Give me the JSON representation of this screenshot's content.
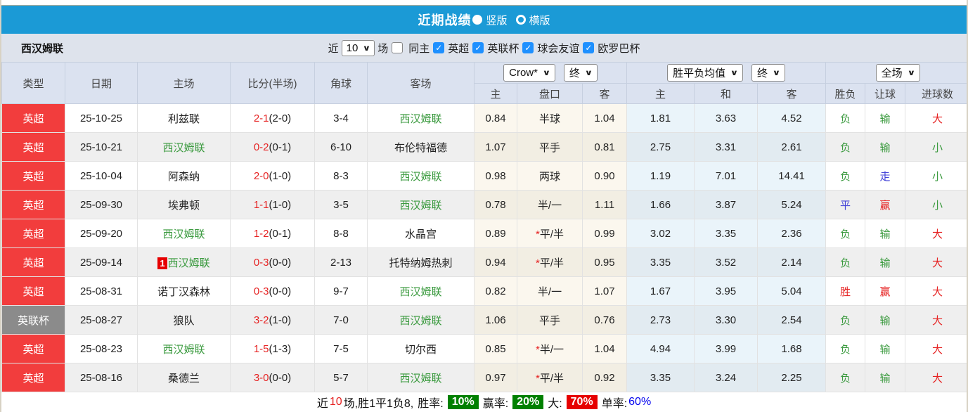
{
  "colors": {
    "titlebar_blue": "#1b9ad6",
    "epl_red": "#f23d3d",
    "cup_gray": "#8b8b8b",
    "team_green": "#3a9a3e",
    "result_red": "#e62222",
    "result_blue": "#4343d8",
    "rate_green_bg": "#008000",
    "rate_red_bg": "#e60000",
    "rate_blue_text": "#0000ee"
  },
  "title_bar": {
    "title": "近期战绩",
    "vertical_label": "竖版",
    "horizontal_label": "横版"
  },
  "filter": {
    "team": "西汉姆联",
    "near_label": "近",
    "match_count": "10",
    "games_label": "场",
    "same_home_label": "同主",
    "leagues": [
      {
        "label": "英超",
        "checked": true
      },
      {
        "label": "英联杯",
        "checked": true
      },
      {
        "label": "球会友谊",
        "checked": true
      },
      {
        "label": "欧罗巴杯",
        "checked": true
      }
    ]
  },
  "table": {
    "left_headers": [
      "类型",
      "日期",
      "主场",
      "比分(半场)",
      "角球",
      "客场"
    ],
    "sub_headers": [
      "主",
      "盘口",
      "客",
      "主",
      "和",
      "客",
      "胜负",
      "让球",
      "进球数"
    ],
    "selects": {
      "company": "Crow*",
      "company_time": "终",
      "europe": "胜平负均值",
      "europe_time": "终",
      "scope": "全场"
    },
    "rows": [
      {
        "league": "英超",
        "league_color": "red",
        "date": "25-10-25",
        "home": {
          "name": "利兹联",
          "self": false,
          "badge": ""
        },
        "score": {
          "ft": "2-1",
          "ht": "(2-0)"
        },
        "corner": "3-4",
        "away": {
          "name": "西汉姆联",
          "self": true
        },
        "asian": {
          "home": "0.84",
          "handicap": "半球",
          "away": "1.04"
        },
        "europe": {
          "home": "1.81",
          "draw": "3.63",
          "away": "4.52"
        },
        "outcome": {
          "text": "负",
          "color": "green"
        },
        "handicap_result": {
          "text": "输",
          "color": "green"
        },
        "goals": {
          "text": "大",
          "color": "red"
        }
      },
      {
        "league": "英超",
        "league_color": "red",
        "date": "25-10-21",
        "home": {
          "name": "西汉姆联",
          "self": true,
          "badge": ""
        },
        "score": {
          "ft": "0-2",
          "ht": "(0-1)"
        },
        "corner": "6-10",
        "away": {
          "name": "布伦特福德",
          "self": false
        },
        "asian": {
          "home": "1.07",
          "handicap": "平手",
          "away": "0.81"
        },
        "europe": {
          "home": "2.75",
          "draw": "3.31",
          "away": "2.61"
        },
        "outcome": {
          "text": "负",
          "color": "green"
        },
        "handicap_result": {
          "text": "输",
          "color": "green"
        },
        "goals": {
          "text": "小",
          "color": "green"
        }
      },
      {
        "league": "英超",
        "league_color": "red",
        "date": "25-10-04",
        "home": {
          "name": "阿森纳",
          "self": false,
          "badge": ""
        },
        "score": {
          "ft": "2-0",
          "ht": "(1-0)"
        },
        "corner": "8-3",
        "away": {
          "name": "西汉姆联",
          "self": true
        },
        "asian": {
          "home": "0.98",
          "handicap": "两球",
          "away": "0.90"
        },
        "europe": {
          "home": "1.19",
          "draw": "7.01",
          "away": "14.41"
        },
        "outcome": {
          "text": "负",
          "color": "green"
        },
        "handicap_result": {
          "text": "走",
          "color": "blue"
        },
        "goals": {
          "text": "小",
          "color": "green"
        }
      },
      {
        "league": "英超",
        "league_color": "red",
        "date": "25-09-30",
        "home": {
          "name": "埃弗顿",
          "self": false,
          "badge": ""
        },
        "score": {
          "ft": "1-1",
          "ht": "(1-0)"
        },
        "corner": "3-5",
        "away": {
          "name": "西汉姆联",
          "self": true
        },
        "asian": {
          "home": "0.78",
          "handicap": "半/一",
          "away": "1.11"
        },
        "europe": {
          "home": "1.66",
          "draw": "3.87",
          "away": "5.24"
        },
        "outcome": {
          "text": "平",
          "color": "blue"
        },
        "handicap_result": {
          "text": "赢",
          "color": "red"
        },
        "goals": {
          "text": "小",
          "color": "green"
        }
      },
      {
        "league": "英超",
        "league_color": "red",
        "date": "25-09-20",
        "home": {
          "name": "西汉姆联",
          "self": true,
          "badge": ""
        },
        "score": {
          "ft": "1-2",
          "ht": "(0-1)"
        },
        "corner": "8-8",
        "away": {
          "name": "水晶宫",
          "self": false
        },
        "asian": {
          "home": "0.89",
          "handicap": "*平/半",
          "away": "0.99"
        },
        "europe": {
          "home": "3.02",
          "draw": "3.35",
          "away": "2.36"
        },
        "outcome": {
          "text": "负",
          "color": "green"
        },
        "handicap_result": {
          "text": "输",
          "color": "green"
        },
        "goals": {
          "text": "大",
          "color": "red"
        }
      },
      {
        "league": "英超",
        "league_color": "red",
        "date": "25-09-14",
        "home": {
          "name": "西汉姆联",
          "self": true,
          "badge": "1"
        },
        "score": {
          "ft": "0-3",
          "ht": "(0-0)"
        },
        "corner": "2-13",
        "away": {
          "name": "托特纳姆热刺",
          "self": false
        },
        "asian": {
          "home": "0.94",
          "handicap": "*平/半",
          "away": "0.95"
        },
        "europe": {
          "home": "3.35",
          "draw": "3.52",
          "away": "2.14"
        },
        "outcome": {
          "text": "负",
          "color": "green"
        },
        "handicap_result": {
          "text": "输",
          "color": "green"
        },
        "goals": {
          "text": "大",
          "color": "red"
        }
      },
      {
        "league": "英超",
        "league_color": "red",
        "date": "25-08-31",
        "home": {
          "name": "诺丁汉森林",
          "self": false,
          "badge": ""
        },
        "score": {
          "ft": "0-3",
          "ht": "(0-0)"
        },
        "corner": "9-7",
        "away": {
          "name": "西汉姆联",
          "self": true
        },
        "asian": {
          "home": "0.82",
          "handicap": "半/一",
          "away": "1.07"
        },
        "europe": {
          "home": "1.67",
          "draw": "3.95",
          "away": "5.04"
        },
        "outcome": {
          "text": "胜",
          "color": "red"
        },
        "handicap_result": {
          "text": "赢",
          "color": "red"
        },
        "goals": {
          "text": "大",
          "color": "red"
        }
      },
      {
        "league": "英联杯",
        "league_color": "gray",
        "date": "25-08-27",
        "home": {
          "name": "狼队",
          "self": false,
          "badge": ""
        },
        "score": {
          "ft": "3-2",
          "ht": "(1-0)"
        },
        "corner": "7-0",
        "away": {
          "name": "西汉姆联",
          "self": true
        },
        "asian": {
          "home": "1.06",
          "handicap": "平手",
          "away": "0.76"
        },
        "europe": {
          "home": "2.73",
          "draw": "3.30",
          "away": "2.54"
        },
        "outcome": {
          "text": "负",
          "color": "green"
        },
        "handicap_result": {
          "text": "输",
          "color": "green"
        },
        "goals": {
          "text": "大",
          "color": "red"
        }
      },
      {
        "league": "英超",
        "league_color": "red",
        "date": "25-08-23",
        "home": {
          "name": "西汉姆联",
          "self": true,
          "badge": ""
        },
        "score": {
          "ft": "1-5",
          "ht": "(1-3)"
        },
        "corner": "7-5",
        "away": {
          "name": "切尔西",
          "self": false
        },
        "asian": {
          "home": "0.85",
          "handicap": "*半/一",
          "away": "1.04"
        },
        "europe": {
          "home": "4.94",
          "draw": "3.99",
          "away": "1.68"
        },
        "outcome": {
          "text": "负",
          "color": "green"
        },
        "handicap_result": {
          "text": "输",
          "color": "green"
        },
        "goals": {
          "text": "大",
          "color": "red"
        }
      },
      {
        "league": "英超",
        "league_color": "red",
        "date": "25-08-16",
        "home": {
          "name": "桑德兰",
          "self": false,
          "badge": ""
        },
        "score": {
          "ft": "3-0",
          "ht": "(0-0)"
        },
        "corner": "5-7",
        "away": {
          "name": "西汉姆联",
          "self": true
        },
        "asian": {
          "home": "0.97",
          "handicap": "*平/半",
          "away": "0.92"
        },
        "europe": {
          "home": "3.35",
          "draw": "3.24",
          "away": "2.25"
        },
        "outcome": {
          "text": "负",
          "color": "green"
        },
        "handicap_result": {
          "text": "输",
          "color": "green"
        },
        "goals": {
          "text": "大",
          "color": "red"
        }
      }
    ]
  },
  "footer": {
    "near_label": "近",
    "count": "10",
    "summary": "场,胜1平1负8,",
    "win_rate_label": "胜率:",
    "win_rate": "10%",
    "profit_rate_label": "赢率:",
    "profit_rate": "20%",
    "big_label": "大:",
    "big_rate": "70%",
    "single_rate_label": "单率:",
    "single_rate": "60%"
  }
}
